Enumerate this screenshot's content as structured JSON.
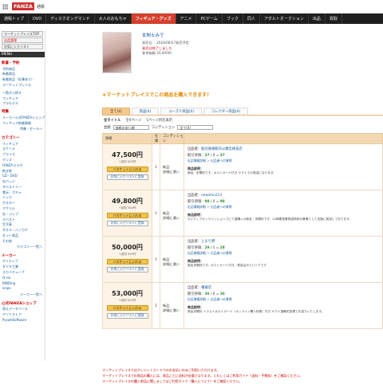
{
  "header": {
    "logo": "FANZA",
    "logo_sub": "通販"
  },
  "nav": [
    "通販トップ",
    "DVD",
    "ディスクオンデマンド",
    "大人のおもちゃ",
    "フィギュア・グッズ",
    "アニメ",
    "PCゲーム",
    "ブック",
    "同人",
    "アダルトオークション",
    "出品",
    "買取"
  ],
  "sidebar": {
    "buttons": [
      "マーケットプレイスTOP",
      "出品管理",
      "お気に入りリスト"
    ],
    "menu_header": "MENU",
    "sec_new": "新着・予約",
    "new_links": [
      "予約商品",
      "新着商品",
      "新着商品（在庫あり）",
      "マーケットプレイス"
    ],
    "feature_links": [
      "一覧から探す",
      "フィギュア",
      "プラモデル"
    ],
    "sec_special": "特集",
    "special_links": [
      "メーカー公式FANZAショップ",
      "フィギュア新着情報"
    ],
    "more1": "特集・セールへ",
    "category_header": "カテゴリー",
    "category_links": [
      "フィギュア",
      "スケール",
      "プライズ",
      "グッズ",
      "FANZAコラボ",
      "抱き枕",
      "CD・DVD",
      "缶バッジ",
      "タペストリー",
      "食玩・ガチャ",
      "トレカ",
      "ポスター",
      "アクリル",
      "缶・コップ",
      "ラバスト",
      "生写真",
      "タオル・ハンカチ",
      "セット商品",
      "その他"
    ],
    "more2": "カテゴリー一覧へ",
    "maker_header": "メーカー",
    "maker_links": [
      "ネイティブ",
      "ダイキ工業",
      "スカイチューブ",
      "Q-six",
      "BINDing",
      "vispo"
    ],
    "more3": "メーカー一覧へ",
    "shop_header": "公式FANZAショップ",
    "shop_links": [
      "萌えデータベース",
      "アソリストア",
      "PurpleSoftware"
    ]
  },
  "product": {
    "title": "女剣士みで",
    "release": "発売日： 2024/06/27発売予定",
    "status": "発売は終了しました",
    "price": "参考価格 33,000円"
  },
  "notice": "★マーケットプレイスでこの商品を購入できます！",
  "tabs": [
    "全て(4)",
    "新品(4)",
    "ユーズド商品(0)",
    "コレクター商品(0)"
  ],
  "filter": {
    "label": "全タイトル",
    "page": "全4ページ",
    "range": "1ページ目を表示"
  },
  "sort": {
    "label": "並順",
    "value": "価格の安い順",
    "cond_label": "コンディション",
    "cond_value": "全て(4)"
  },
  "table_headers": [
    "価格",
    "在庫",
    "コンディション",
    ""
  ],
  "listings": [
    {
      "price": "47,500円",
      "tax": "+送料 500円",
      "stock": "1",
      "cond": "新品",
      "cond2": "詳細に違い",
      "seller_label": "出品者：",
      "seller": "販売価格販売公爵区株直店",
      "rating": "取引評価：",
      "good": "37",
      "neutral": "0",
      "total": "37",
      "links": "出品情報詳細 ＞ 出品者への質問",
      "desc_h": "商品説明：",
      "desc": "新品、未開封です。ポストカード付き ヤマトでの発送になります。"
    },
    {
      "price": "49,800円",
      "tax": "+送料 500円",
      "stock": "1",
      "cond": "新品",
      "cond2": "詳細に違い",
      "seller_label": "出品者：",
      "seller": "newshin213",
      "rating": "取引評価：",
      "good": "98",
      "neutral": "0",
      "total": "98",
      "links": "出品情報詳細 ＞ 出品者への質問",
      "desc_h": "商品説明：",
      "desc": "ネイティブオンラインショップにて直購入の新品・未開封です。24時間営業発送体制の事業として迅速に発送しております。"
    },
    {
      "price": "50,000円",
      "tax": "+送料 500円",
      "stock": "1",
      "cond": "新品",
      "cond2": "詳細に違い",
      "seller_label": "出品者：",
      "seller": "とまり野",
      "rating": "取引評価：",
      "good": "29",
      "neutral": "1",
      "total": "28",
      "links": "出品情報詳細 ＞ 出品者への質問",
      "desc_h": "商品説明：",
      "desc": "新品未開封です。ポストカード付き。発送はゆうパックです"
    },
    {
      "price": "53,000円",
      "tax": "+送料 500円",
      "stock": "1",
      "cond": "新品",
      "cond2": "詳細に違い",
      "seller_label": "出品者：",
      "seller": "機器店",
      "rating": "取引評価：",
      "good": "36",
      "neutral": "0",
      "total": "36",
      "links": "出品情報詳細 ＞ 出品者への質問",
      "desc_h": "商品説明：",
      "desc": "新品未開封 イラストポストカード（オンライン購入特典）付き ヤマト運輸宅急便でお送りいたします。"
    }
  ],
  "cart_label": "バスケットに入れる",
  "fav_label": "お気に入りリストに登録",
  "footer": [
    "マーケットプレイスではクレジットカードでのお支払いのみご利用いただけます。",
    "マーケットプレイスでの商品の購入には、商品ごとに送料が必要となります。くわしくはご利用ガイド（送料・手数料）をご確認ください。",
    "マーケットプレイスの購入商品に関しましてはご利用ガイド（購入について）をご確認ください。"
  ]
}
